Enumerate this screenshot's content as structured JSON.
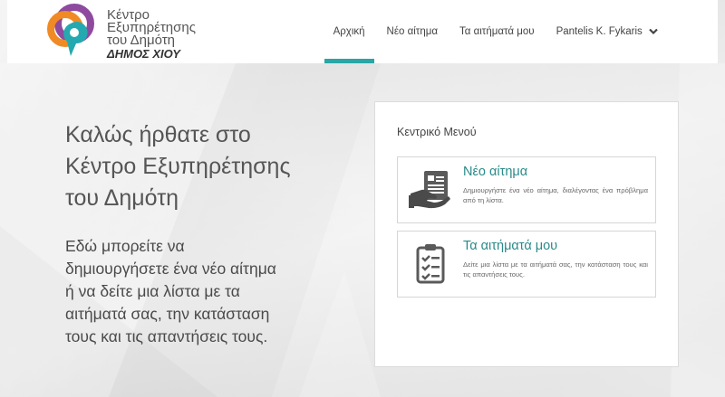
{
  "header": {
    "logo": {
      "line1": "Κέντρο",
      "line2": "Εξυπηρέτησης",
      "line3": "του Δημότη",
      "city": "ΔΗΜΟΣ ΧΙΟΥ"
    },
    "nav": [
      {
        "label": "Αρχική",
        "active": true
      },
      {
        "label": "Νέο αίτημα",
        "active": false
      },
      {
        "label": "Τα αιτήματά μου",
        "active": false
      },
      {
        "label": "Pantelis K. Fykaris",
        "active": false,
        "icon": "chevron-down-icon"
      }
    ]
  },
  "hero": {
    "welcome_lines": [
      "Καλώς ήρθατε στο",
      "Κέντρο Εξυπηρέτησης",
      "του Δημότη"
    ],
    "subtitle_lines": [
      "Εδώ μπορείτε να",
      "δημιουργήσετε ένα νέο αίτημα",
      "ή να δείτε μια λίστα με τα",
      "αιτήματά σας, την κατάσταση",
      "τους και τις απαντήσεις τους."
    ]
  },
  "menu": {
    "title": "Κεντρικό Μενού",
    "cards": [
      {
        "icon": "document-hand-icon",
        "title": "Νέο αίτημα",
        "description": "Δημιουργήστε ένα νέο αίτημα, διαλέγοντας ένα πρόβλημα από τη λίστα."
      },
      {
        "icon": "clipboard-checklist-icon",
        "title": "Τα αιτήματά μου",
        "description": "Δείτε μια λίστα με τα αιτήματά σας, την κατάσταση τους και τις απαντήσεις τους."
      }
    ]
  },
  "colors": {
    "accent": "#2aa6a6",
    "card_title": "#2a8a8a",
    "logo_purple": "#8e4a9e",
    "logo_orange": "#f08a24",
    "logo_teal": "#25a9b0"
  }
}
